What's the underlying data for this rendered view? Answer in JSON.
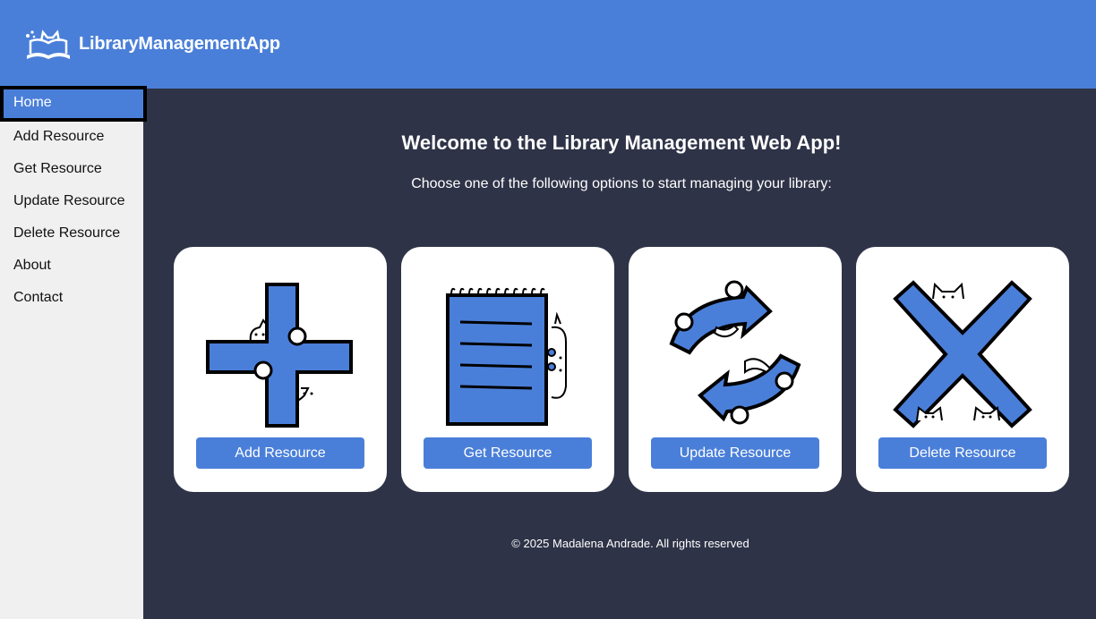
{
  "header": {
    "app_title": "LibraryManagementApp",
    "logo_icon": "cat-book-logo-icon",
    "color": "#4a7fd9"
  },
  "sidebar": {
    "items": [
      {
        "label": "Home",
        "active": true
      },
      {
        "label": "Add Resource"
      },
      {
        "label": "Get Resource"
      },
      {
        "label": "Update Resource"
      },
      {
        "label": "Delete Resource"
      },
      {
        "label": "About"
      },
      {
        "label": "Contact"
      }
    ]
  },
  "main": {
    "welcome": "Welcome to the Library Management Web App!",
    "subtitle": "Choose one of the following options to start managing your library:",
    "cards": [
      {
        "icon": "plus-cat-icon",
        "button": "Add Resource"
      },
      {
        "icon": "notebook-cat-icon",
        "button": "Get Resource"
      },
      {
        "icon": "refresh-cat-icon",
        "button": "Update Resource"
      },
      {
        "icon": "x-cat-icon",
        "button": "Delete Resource"
      }
    ]
  },
  "footer": {
    "text": "© 2025 Madalena Andrade. All rights reserved"
  },
  "colors": {
    "accent": "#4a7fd9",
    "background": "#2e3347",
    "sidebar": "#f0f0f0"
  }
}
